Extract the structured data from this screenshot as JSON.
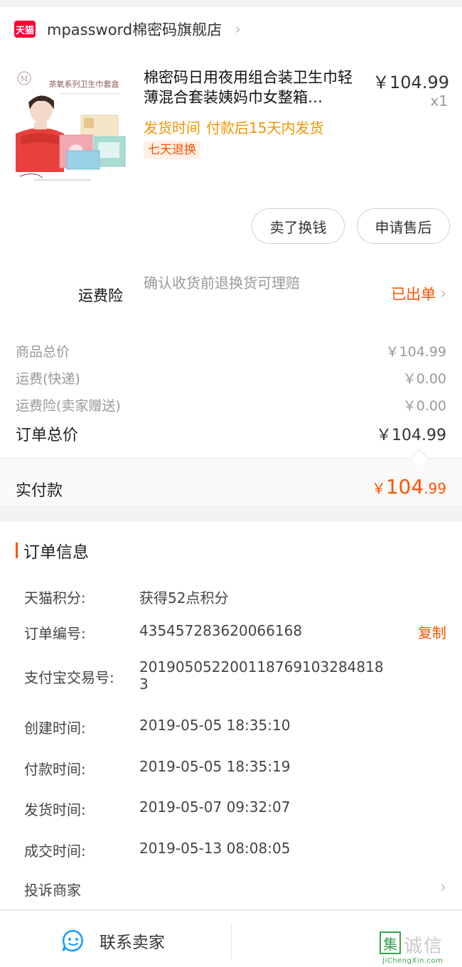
{
  "shop": {
    "badge": "天猫",
    "name": "mpassword棉密码旗舰店"
  },
  "product": {
    "title": "棉密码日用夜用组合装卫生巾轻薄混合套装姨妈巾女整箱…",
    "price": "￥104.99",
    "quantity": "x1",
    "ship_label": "发货时间",
    "ship_value": "付款后15天内发货",
    "return_tag": "七天退换",
    "image_caption": "茶氧系列卫生巾套盒"
  },
  "actions": {
    "sell_label": "卖了换钱",
    "aftersale_label": "申请售后"
  },
  "insurance": {
    "label": "运费险",
    "description": "确认收货前退换货可理赔",
    "status": "已出单"
  },
  "price_breakdown": {
    "items": [
      {
        "label": "商品总价",
        "value": "￥104.99"
      },
      {
        "label": "运费(快递)",
        "value": "￥0.00"
      },
      {
        "label": "运费险(卖家赠送)",
        "value": "￥0.00"
      }
    ],
    "total_label": "订单总价",
    "total_value": "￥104.99",
    "paid_label": "实付款",
    "paid_currency": "￥",
    "paid_int": "104",
    "paid_dec": ".99"
  },
  "order_info": {
    "title": "订单信息",
    "points_label": "天猫积分:",
    "points_value": "获得52点积分",
    "order_no_label": "订单编号:",
    "order_no_value": "435457283620066168",
    "copy_label": "复制",
    "alipay_label": "支付宝交易号:",
    "alipay_value": "2019050522001187691032848183",
    "created_label": "创建时间:",
    "created_value": "2019-05-05 18:35:10",
    "paid_label": "付款时间:",
    "paid_value": "2019-05-05 18:35:19",
    "shipped_label": "发货时间:",
    "shipped_value": "2019-05-07 09:32:07",
    "closed_label": "成交时间:",
    "closed_value": "2019-05-13 08:08:05",
    "complain_label": "投诉商家"
  },
  "bottom_bar": {
    "contact_label": "联系卖家"
  },
  "watermark": {
    "box_char": "集",
    "chars": "诚信",
    "url": "JiChengXin.com"
  },
  "colors": {
    "accent": "#ff5000",
    "ship_time": "#f49400",
    "tmall_red": "#ff0036",
    "chat_blue": "#1aa0ff"
  }
}
